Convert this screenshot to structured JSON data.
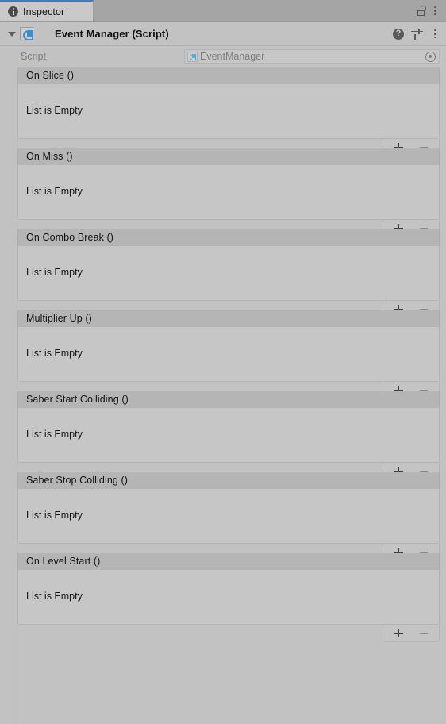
{
  "window": {
    "tab": {
      "label": "Inspector",
      "icon": "info-icon"
    },
    "lock_icon": "lock-open-icon",
    "menu_icon": "kebab-menu-icon"
  },
  "component": {
    "title": "Event Manager (Script)",
    "foldout_expanded": true,
    "icon": "csharp-script-icon",
    "help_icon": "help-icon",
    "preset_icon": "preset-settings-icon",
    "menu_icon": "kebab-menu-icon"
  },
  "script_row": {
    "label": "Script",
    "value": "EventManager",
    "icon": "csharp-script-icon",
    "picker_icon": "object-picker-icon",
    "disabled": true
  },
  "list_buttons": {
    "add_label": "+",
    "remove_label": "−",
    "add_icon": "plus-icon",
    "remove_icon": "minus-icon"
  },
  "empty_text": "List is Empty",
  "events": [
    {
      "name": "On Slice ()"
    },
    {
      "name": "On Miss ()"
    },
    {
      "name": "On Combo Break ()"
    },
    {
      "name": "Multiplier Up ()"
    },
    {
      "name": "Saber Start Colliding ()"
    },
    {
      "name": "Saber Stop Colliding ()"
    },
    {
      "name": "On Level Start ()"
    }
  ],
  "colors": {
    "background": "#c2c2c2",
    "tabbar": "#a5a5a5",
    "tab_active": "#c9c9c9",
    "tab_accent": "#3d7cc9",
    "section_header": "#b5b5b5",
    "section_body": "#c6c6c6",
    "text": "#131313",
    "text_muted": "#7e7e7e",
    "script_icon_blue": "#3d8fd4"
  }
}
